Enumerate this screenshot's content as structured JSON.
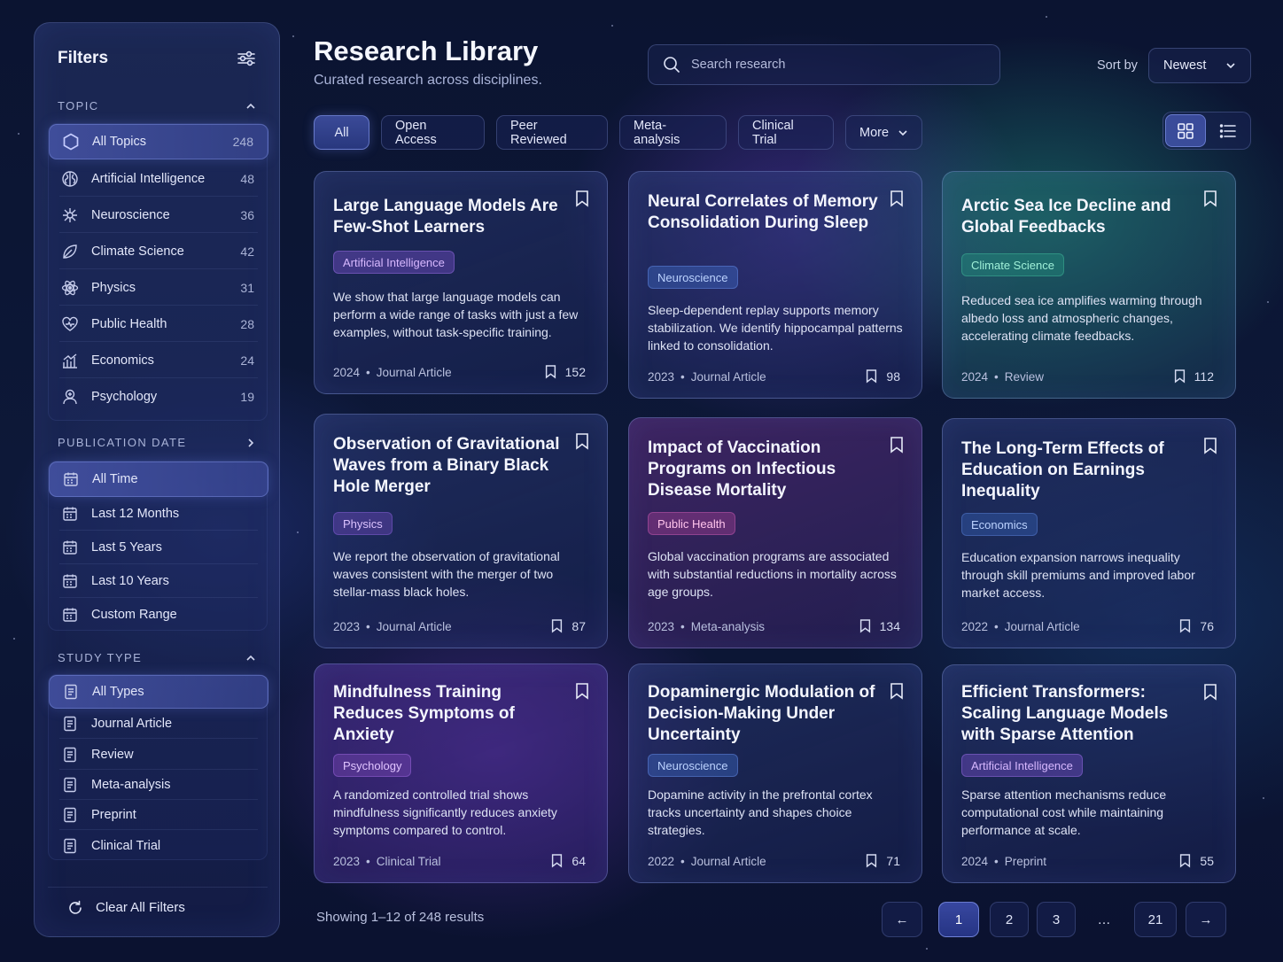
{
  "sidebar": {
    "title": "Filters",
    "topic": {
      "label": "TOPIC",
      "items": [
        {
          "label": "All Topics",
          "count": "248"
        },
        {
          "label": "Artificial Intelligence",
          "count": "48"
        },
        {
          "label": "Neuroscience",
          "count": "36"
        },
        {
          "label": "Climate Science",
          "count": "42"
        },
        {
          "label": "Physics",
          "count": "31"
        },
        {
          "label": "Public Health",
          "count": "28"
        },
        {
          "label": "Economics",
          "count": "24"
        },
        {
          "label": "Psychology",
          "count": "19"
        }
      ]
    },
    "date": {
      "label": "PUBLICATION DATE",
      "items": [
        {
          "label": "All Time"
        },
        {
          "label": "Last 12 Months"
        },
        {
          "label": "Last 5 Years"
        },
        {
          "label": "Last 10 Years"
        },
        {
          "label": "Custom Range"
        }
      ]
    },
    "study": {
      "label": "STUDY TYPE",
      "items": [
        {
          "label": "All Types"
        },
        {
          "label": "Journal Article"
        },
        {
          "label": "Review"
        },
        {
          "label": "Meta-analysis"
        },
        {
          "label": "Preprint"
        },
        {
          "label": "Clinical Trial"
        }
      ]
    },
    "clear_label": "Clear All Filters"
  },
  "header": {
    "title": "Research Library",
    "subtitle": "Curated research across disciplines.",
    "search_placeholder": "Search research",
    "sort_label": "Sort by",
    "sort_value": "Newest"
  },
  "chips": [
    "All",
    "Open Access",
    "Peer Reviewed",
    "Meta-analysis",
    "Clinical Trial",
    "More"
  ],
  "cards": [
    {
      "title": "Large Language Models Are Few-Shot Learners",
      "tag": "Artificial Intelligence",
      "desc": "We show that large language models can perform a wide range of tasks with just a few examples, without task-specific training.",
      "year": "2024",
      "type": "Journal Article",
      "saves": "152"
    },
    {
      "title": "Neural Correlates of Memory Consolidation During Sleep",
      "tag": "Neuroscience",
      "desc": "Sleep-dependent replay supports memory stabilization. We identify hippocampal patterns linked to consolidation.",
      "year": "2023",
      "type": "Journal Article",
      "saves": "98"
    },
    {
      "title": "Arctic Sea Ice Decline and Global Feedbacks",
      "tag": "Climate Science",
      "desc": "Reduced sea ice amplifies warming through albedo loss and atmospheric changes, accelerating climate feedbacks.",
      "year": "2024",
      "type": "Review",
      "saves": "112"
    },
    {
      "title": "Observation of Gravitational Waves from a Binary Black Hole Merger",
      "tag": "Physics",
      "desc": "We report the observation of gravitational waves consistent with the merger of two stellar-mass black holes.",
      "year": "2023",
      "type": "Journal Article",
      "saves": "87"
    },
    {
      "title": "Impact of Vaccination Programs on Infectious Disease Mortality",
      "tag": "Public Health",
      "desc": "Global vaccination programs are associated with substantial reductions in mortality across age groups.",
      "year": "2023",
      "type": "Meta-analysis",
      "saves": "134"
    },
    {
      "title": "The Long-Term Effects of Education on Earnings Inequality",
      "tag": "Economics",
      "desc": "Education expansion narrows inequality through skill premiums and improved labor market access.",
      "year": "2022",
      "type": "Journal Article",
      "saves": "76"
    },
    {
      "title": "Mindfulness Training Reduces Symptoms of Anxiety",
      "tag": "Psychology",
      "desc": "A randomized controlled trial shows mindfulness significantly reduces anxiety symptoms compared to control.",
      "year": "2023",
      "type": "Clinical Trial",
      "saves": "64"
    },
    {
      "title": "Dopaminergic Modulation of Decision-Making Under Uncertainty",
      "tag": "Neuroscience",
      "desc": "Dopamine activity in the prefrontal cortex tracks uncertainty and shapes choice strategies.",
      "year": "2022",
      "type": "Journal Article",
      "saves": "71"
    },
    {
      "title": "Efficient Transformers: Scaling Language Models with Sparse Attention",
      "tag": "Artificial Intelligence",
      "desc": "Sparse attention mechanisms reduce computational cost while maintaining performance at scale.",
      "year": "2024",
      "type": "Preprint",
      "saves": "55"
    }
  ],
  "footer": {
    "showing": "Showing 1–12 of 248 results",
    "pages": [
      "1",
      "2",
      "3",
      "…",
      "21"
    ],
    "prev": "←",
    "next": "→"
  },
  "colors": {
    "accent": "#5f6fd8",
    "background": "#0c1535"
  }
}
